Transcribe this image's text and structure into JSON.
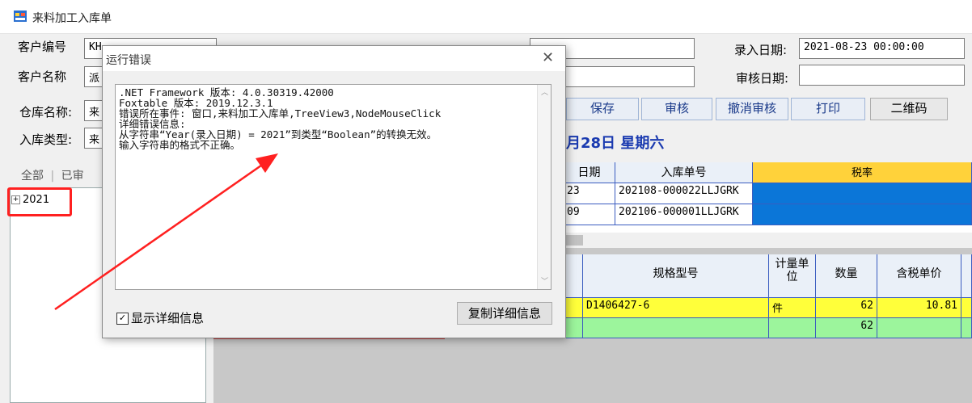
{
  "window": {
    "title": "来料加工入库单"
  },
  "form": {
    "customer_no_label": "客户编号",
    "customer_no_value": "KH",
    "customer_name_label": "客户名称",
    "customer_name_value": "派",
    "warehouse_label": "仓库名称:",
    "warehouse_value": "来",
    "inbound_type_label": "入库类型:",
    "inbound_type_value": "来",
    "entry_date_label": "录入日期:",
    "entry_date_value": "2021-08-23 00:00:00",
    "audit_date_label": "审核日期:",
    "audit_date_value": "",
    "tab_all": "全部",
    "tab_audited": "已审"
  },
  "toolbar": {
    "save": "保存",
    "audit": "审核",
    "cancel_audit": "撤消审核",
    "print": "打印",
    "qrcode": "二维码"
  },
  "date_banner": "月28日  星期六",
  "tree": {
    "node": "2021"
  },
  "top_grid": {
    "headers": [
      "日期",
      "入库单号",
      "税率"
    ],
    "rows": [
      [
        "23",
        "202108-000022LLJGRK"
      ],
      [
        "09",
        "202106-000001LLJGRK"
      ]
    ]
  },
  "detail_grid": {
    "headers": [
      "规格型号",
      "计量单位",
      "数量",
      "含税单价"
    ],
    "rows": [
      {
        "spec": "D1406427-6",
        "unit": "件",
        "qty": "62",
        "price": "10.81"
      },
      {
        "spec": "",
        "unit": "",
        "qty": "62",
        "price": ""
      }
    ]
  },
  "dialog": {
    "title": "运行错误",
    "error_text": ".NET Framework 版本: 4.0.30319.42000\nFoxtable 版本: 2019.12.3.1\n错误所在事件: 窗口,来料加工入库单,TreeView3,NodeMouseClick\n详细错误信息:\n从字符串“Year(录入日期) = 2021”到类型“Boolean”的转换无效。\n输入字符串的格式不正确。",
    "show_details_label": "显示详细信息",
    "copy_button": "复制详细信息"
  },
  "colors": {
    "annotation": "#ff2020",
    "cell_blue": "#0b76d8",
    "row_yellow": "#ffff3a",
    "row_green": "#9cf59c"
  }
}
